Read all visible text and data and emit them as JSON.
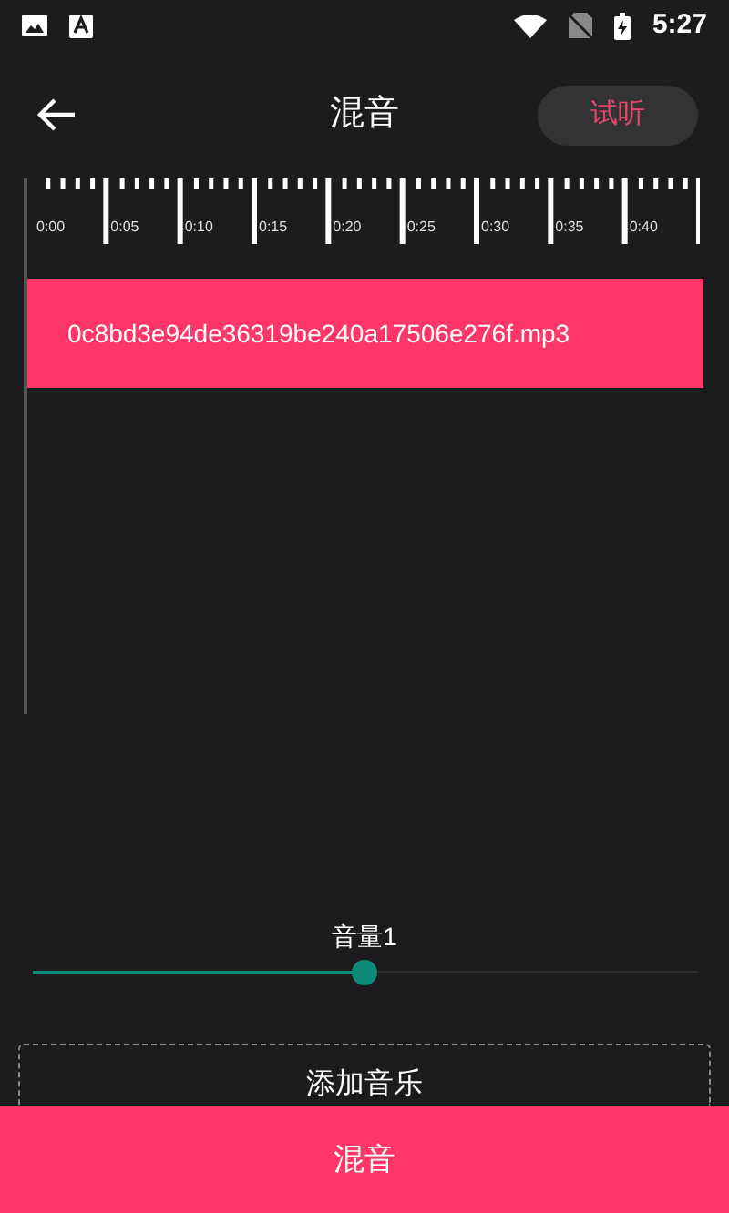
{
  "status_bar": {
    "time": "5:27"
  },
  "toolbar": {
    "title": "混音",
    "preview_button": "试听"
  },
  "ruler": {
    "labels": [
      "0:00",
      "0:05",
      "0:10",
      "0:15",
      "0:20",
      "0:25",
      "0:30",
      "0:35",
      "0:40"
    ]
  },
  "tracks": [
    {
      "name": "0c8bd3e94de36319be240a17506e276f.mp3"
    }
  ],
  "volumes": [
    {
      "label": "音量1",
      "level": 0.5
    }
  ],
  "add_button": "添加音乐",
  "mix_button": "混音"
}
